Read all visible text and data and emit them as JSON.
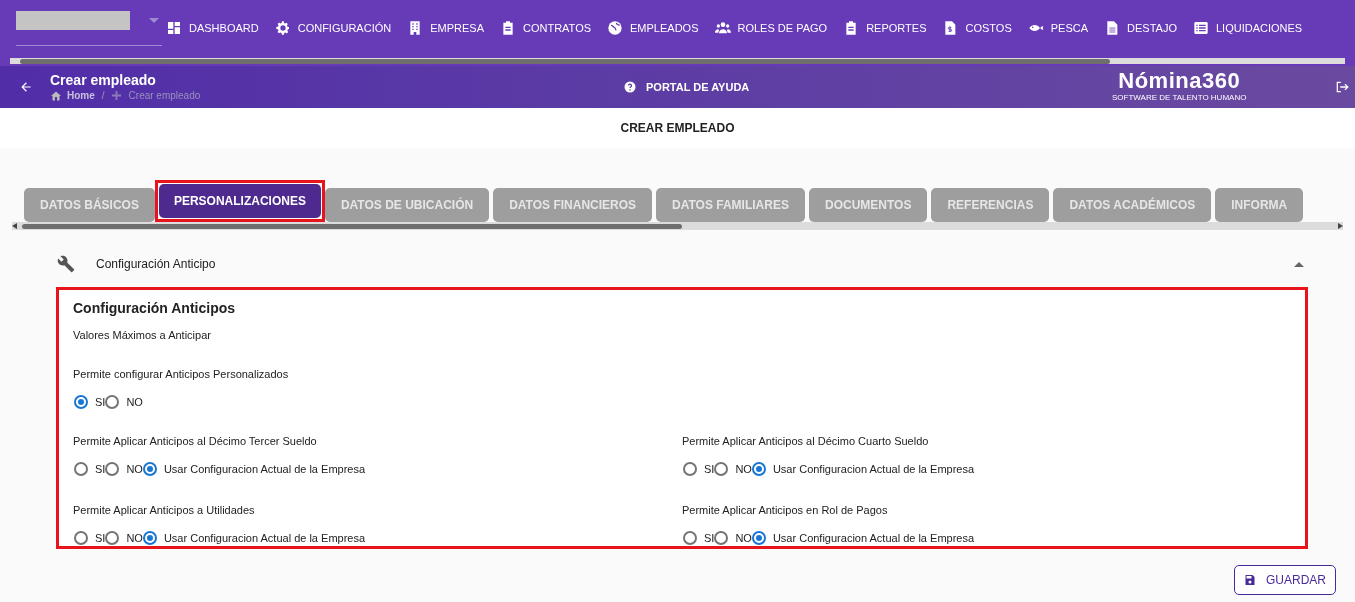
{
  "top_nav": {
    "items": [
      {
        "label": "DASHBOARD"
      },
      {
        "label": "CONFIGURACIÓN"
      },
      {
        "label": "EMPRESA"
      },
      {
        "label": "CONTRATOS"
      },
      {
        "label": "EMPLEADOS"
      },
      {
        "label": "ROLES DE PAGO"
      },
      {
        "label": "REPORTES"
      },
      {
        "label": "COSTOS"
      },
      {
        "label": "PESCA"
      },
      {
        "label": "DESTAJO"
      },
      {
        "label": "LIQUIDACIONES"
      }
    ]
  },
  "header": {
    "title": "Crear empleado",
    "breadcrumb": [
      "Home",
      "/",
      "Crear empleado"
    ],
    "help_link": "PORTAL DE AYUDA",
    "logo": {
      "name": "Nómina360",
      "tagline": "SOFTWARE DE TALENTO HUMANO"
    }
  },
  "page_title": "CREAR EMPLEADO",
  "tabs": [
    {
      "label": "DATOS BÁSICOS",
      "selected": false,
      "highlighted": false
    },
    {
      "label": "PERSONALIZACIONES",
      "selected": true,
      "highlighted": true
    },
    {
      "label": "DATOS DE UBICACIÓN",
      "selected": false,
      "highlighted": false
    },
    {
      "label": "DATOS FINANCIEROS",
      "selected": false,
      "highlighted": false
    },
    {
      "label": "DATOS FAMILIARES",
      "selected": false,
      "highlighted": false
    },
    {
      "label": "DOCUMENTOS",
      "selected": false,
      "highlighted": false
    },
    {
      "label": "REFERENCIAS",
      "selected": false,
      "highlighted": false
    },
    {
      "label": "DATOS ACADÉMICOS",
      "selected": false,
      "highlighted": false
    },
    {
      "label": "INFORMA",
      "selected": false,
      "highlighted": false
    }
  ],
  "accordion": {
    "title": "Configuración Anticipo",
    "expanded": true
  },
  "section": {
    "title": "Configuración Anticipos",
    "subtitle": "Valores Máximos a Anticipar",
    "highlighted": true,
    "groups": [
      {
        "label": "Permite configurar Anticipos Personalizados",
        "full_width": true,
        "options": [
          {
            "label": "SI",
            "selected": true
          },
          {
            "label": "NO",
            "selected": false
          }
        ]
      },
      {
        "label": "Permite Aplicar Anticipos al Décimo Tercer Sueldo",
        "full_width": false,
        "options": [
          {
            "label": "SI",
            "selected": false
          },
          {
            "label": "NO",
            "selected": false
          },
          {
            "label": "Usar Configuracion Actual de la Empresa",
            "selected": true
          }
        ]
      },
      {
        "label": "Permite Aplicar Anticipos al Décimo Cuarto Sueldo",
        "full_width": false,
        "options": [
          {
            "label": "SI",
            "selected": false
          },
          {
            "label": "NO",
            "selected": false
          },
          {
            "label": "Usar Configuracion Actual de la Empresa",
            "selected": true
          }
        ]
      },
      {
        "label": "Permite Aplicar Anticipos a Utilidades",
        "full_width": false,
        "options": [
          {
            "label": "SI",
            "selected": false
          },
          {
            "label": "NO",
            "selected": false
          },
          {
            "label": "Usar Configuracion Actual de la Empresa",
            "selected": true
          }
        ]
      },
      {
        "label": "Permite Aplicar Anticipos en Rol de Pagos",
        "full_width": false,
        "options": [
          {
            "label": "SI",
            "selected": false
          },
          {
            "label": "NO",
            "selected": false
          },
          {
            "label": "Usar Configuracion Actual de la Empresa",
            "selected": true
          }
        ]
      }
    ]
  },
  "save_button": "GUARDAR"
}
